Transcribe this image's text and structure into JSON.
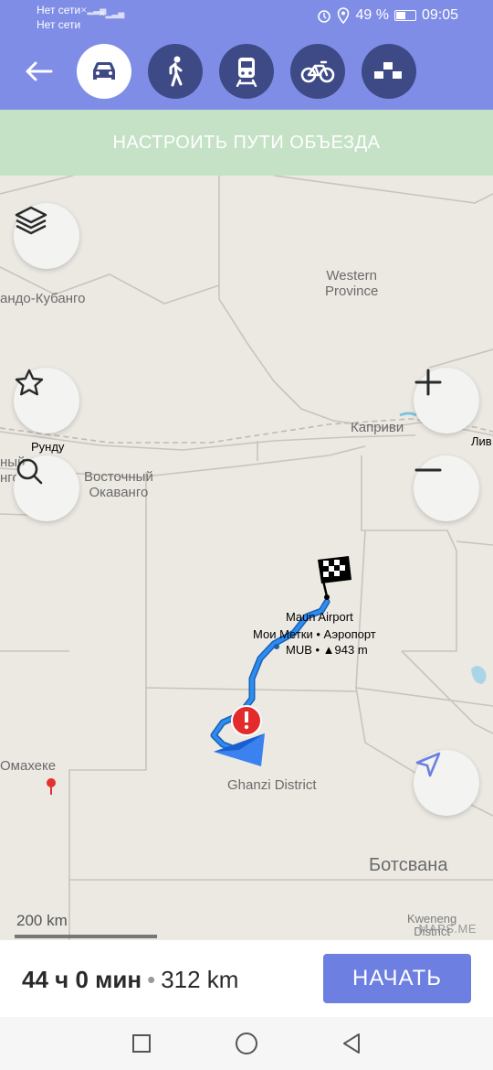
{
  "status_bar": {
    "sim1": "Нет сети",
    "sim2": "Нет сети",
    "battery": "49 %",
    "battery_level": 0.49,
    "time": "09:05"
  },
  "transport_modes": [
    {
      "name": "car",
      "icon": "car-icon",
      "active": true
    },
    {
      "name": "walk",
      "icon": "walker-icon",
      "active": false
    },
    {
      "name": "transit",
      "icon": "train-icon",
      "active": false
    },
    {
      "name": "bike",
      "icon": "bicycle-icon",
      "active": false
    },
    {
      "name": "taxi",
      "icon": "taxi-icon",
      "active": false
    }
  ],
  "banner": {
    "label": "НАСТРОИТЬ ПУТИ ОБЪЕЗДА"
  },
  "map": {
    "labels": {
      "western_province": "Western\nProvince",
      "cuando": "андо-Кубанго",
      "rundu": "Рунду",
      "kavango_east": "Восточный\nОкаванго",
      "caprivi": "Каприви",
      "liv": "Лив",
      "left_frag": "ный\nнго",
      "omaheke": "Омахеке",
      "ghanzi": "Ghanzi District",
      "botswana": "Ботсвана",
      "kweneng": "Kweneng\nDistrict"
    },
    "destination": {
      "name": "Maun Airport",
      "line2": "Мои Метки • Аэропорт",
      "line3": "MUB • ▲943 m"
    },
    "scale": "200 km",
    "watermark": "MAPS.ME"
  },
  "route": {
    "time": "44 ч 0 мин",
    "separator": "•",
    "distance": "312 km"
  },
  "start_button": "НАЧАТЬ",
  "colors": {
    "toolbar": "#7f8de6",
    "mode_bg": "#3e4a86",
    "route": "#1e7ce8",
    "banner": "#c5e2c7",
    "start": "#6d7fe0"
  }
}
